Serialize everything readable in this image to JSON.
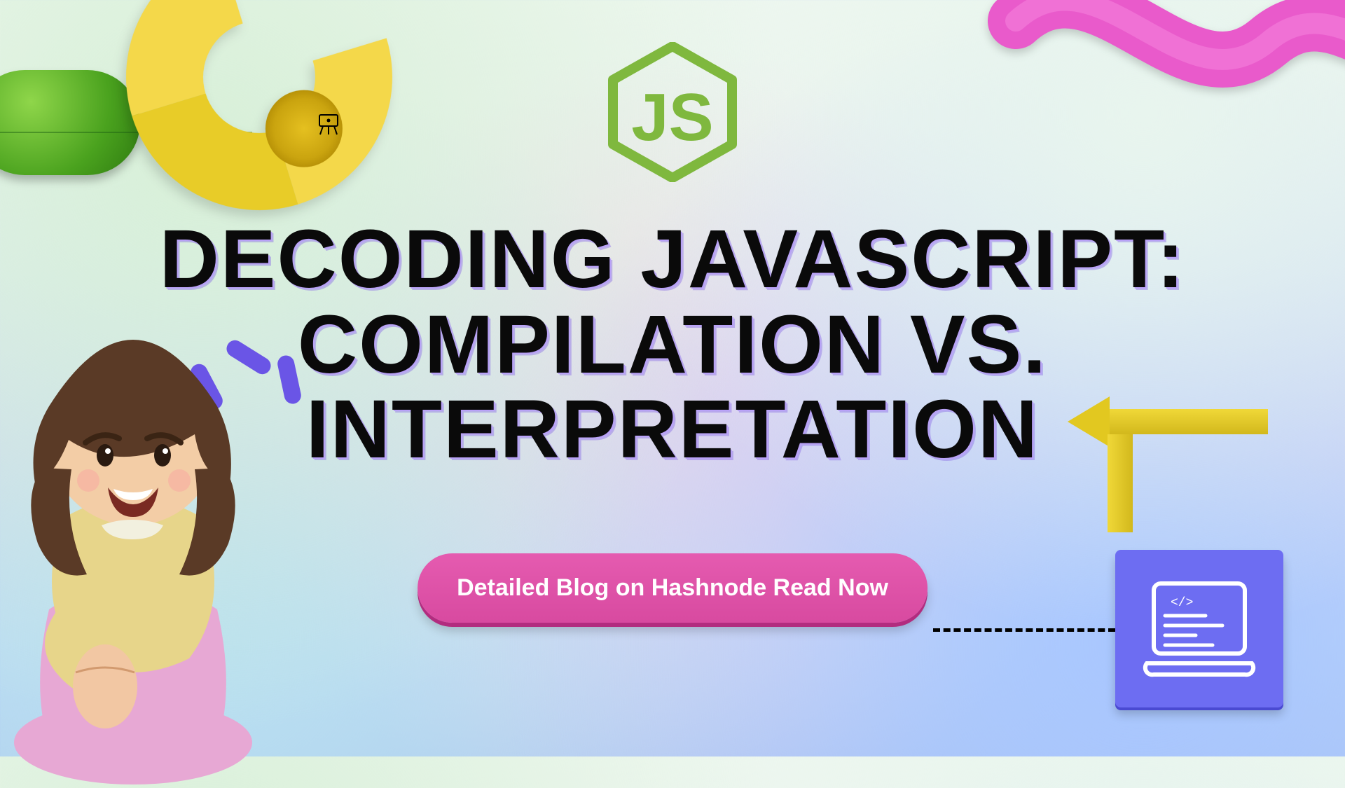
{
  "title": "DECODING JAVASCRIPT: COMPILATION VS. INTERPRETATION",
  "cta_label": "Detailed Blog on Hashnode Read Now",
  "logo": {
    "text": "JS"
  },
  "colors": {
    "accent_pink": "#d84aa0",
    "accent_purple": "#6d6df2",
    "accent_green": "#4aa21e",
    "accent_yellow": "#e8cc28",
    "js_green": "#83b84a"
  }
}
